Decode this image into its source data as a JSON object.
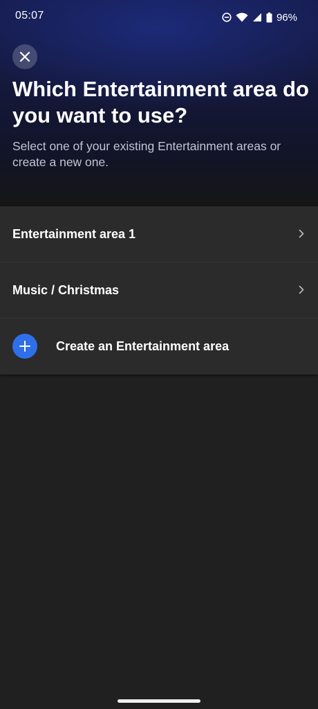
{
  "status_bar": {
    "time": "05:07",
    "battery": "96%",
    "icons": [
      "do-not-disturb-icon",
      "wifi-icon",
      "cellular-signal-icon",
      "battery-icon"
    ]
  },
  "header": {
    "title": "Which Entertainment area do you want to use?",
    "subtitle": "Select one of your existing Entertainment areas or create a new one."
  },
  "areas": [
    {
      "label": "Entertainment area 1"
    },
    {
      "label": "Music / Christmas"
    }
  ],
  "create": {
    "label": "Create an Entertainment area"
  },
  "colors": {
    "accent": "#2f6fea",
    "background": "#202020",
    "list_background": "#2b2b2b",
    "header_top": "#161b4a"
  }
}
